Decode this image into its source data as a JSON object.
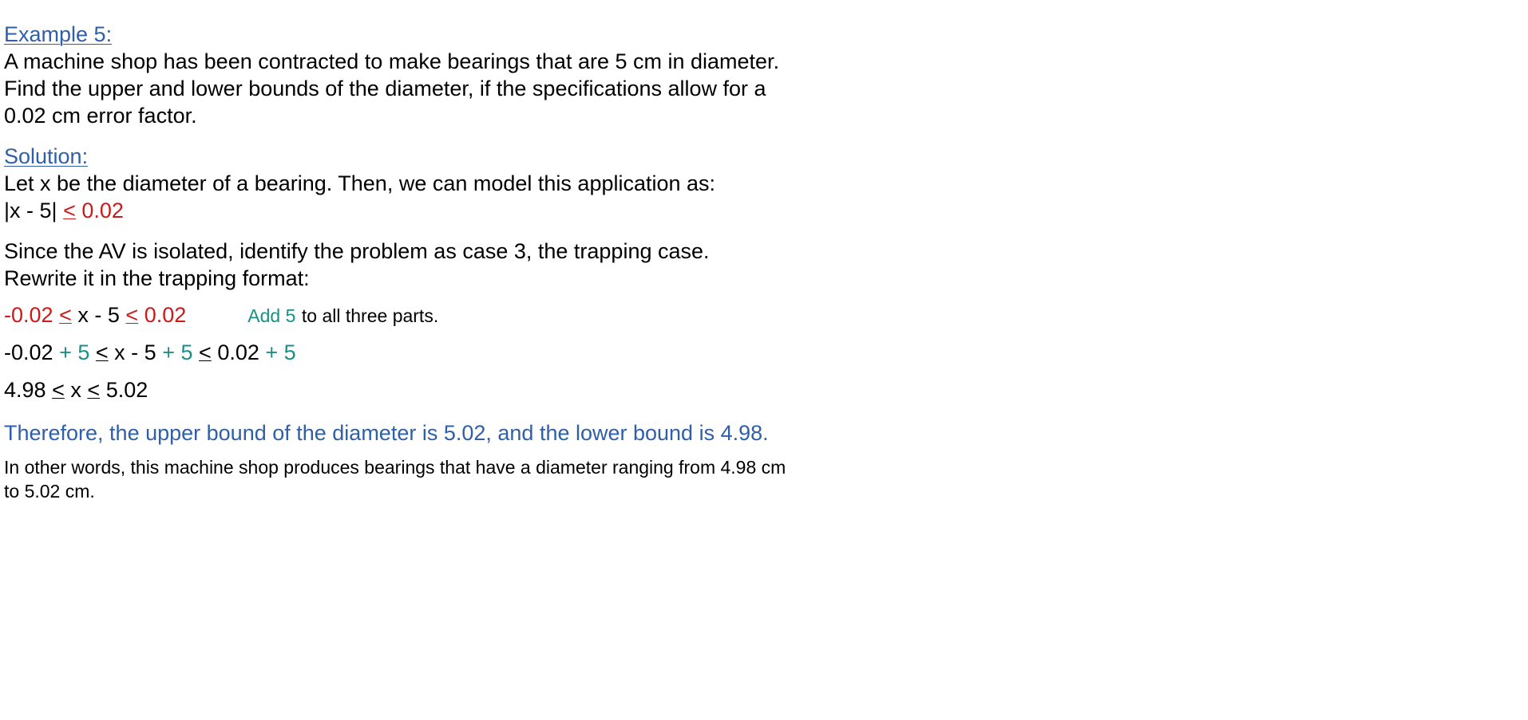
{
  "example": {
    "heading": "Example 5:",
    "problem_lines": [
      "A machine shop has been contracted to make bearings that are 5 cm in diameter.",
      "Find the upper and lower bounds of the diameter, if the specifications allow for a",
      "0.02 cm error factor."
    ]
  },
  "solution": {
    "heading": "Solution:",
    "model_line": "Let x be the diameter of a bearing.  Then, we can model this application as:",
    "model_inequality": {
      "left": "|x - 5|",
      "le": "<",
      "right": "0.02"
    },
    "case_lines": [
      "Since the AV is isolated, identify the problem as case 3, the trapping case.",
      "Rewrite it in the trapping format:"
    ],
    "trap_step": {
      "neg": "-0.02",
      "le1": "<",
      "middle": "x - 5",
      "le2": "<",
      "pos": "0.02",
      "note_colored": "Add 5",
      "note_rest": "to all three parts."
    },
    "add_step": {
      "neg": "-0.02",
      "plus1": "+ 5",
      "le1": "<",
      "middle": "x - 5",
      "plus2": "+ 5",
      "le2": "<",
      "pos": "0.02",
      "plus3": "+ 5"
    },
    "result_step": {
      "left": "4.98",
      "le1": "<",
      "middle": "x",
      "le2": "<",
      "right": "5.02"
    },
    "conclusion": "Therefore, the upper bound of the diameter is 5.02, and the lower bound is 4.98.",
    "other_words": [
      "In other words, this machine shop produces bearings that have a diameter ranging from 4.98 cm",
      "to 5.02 cm."
    ]
  },
  "colors": {
    "heading_blue": "#2f5fa8",
    "red": "#cc1a1a",
    "teal": "#1a8f87"
  }
}
